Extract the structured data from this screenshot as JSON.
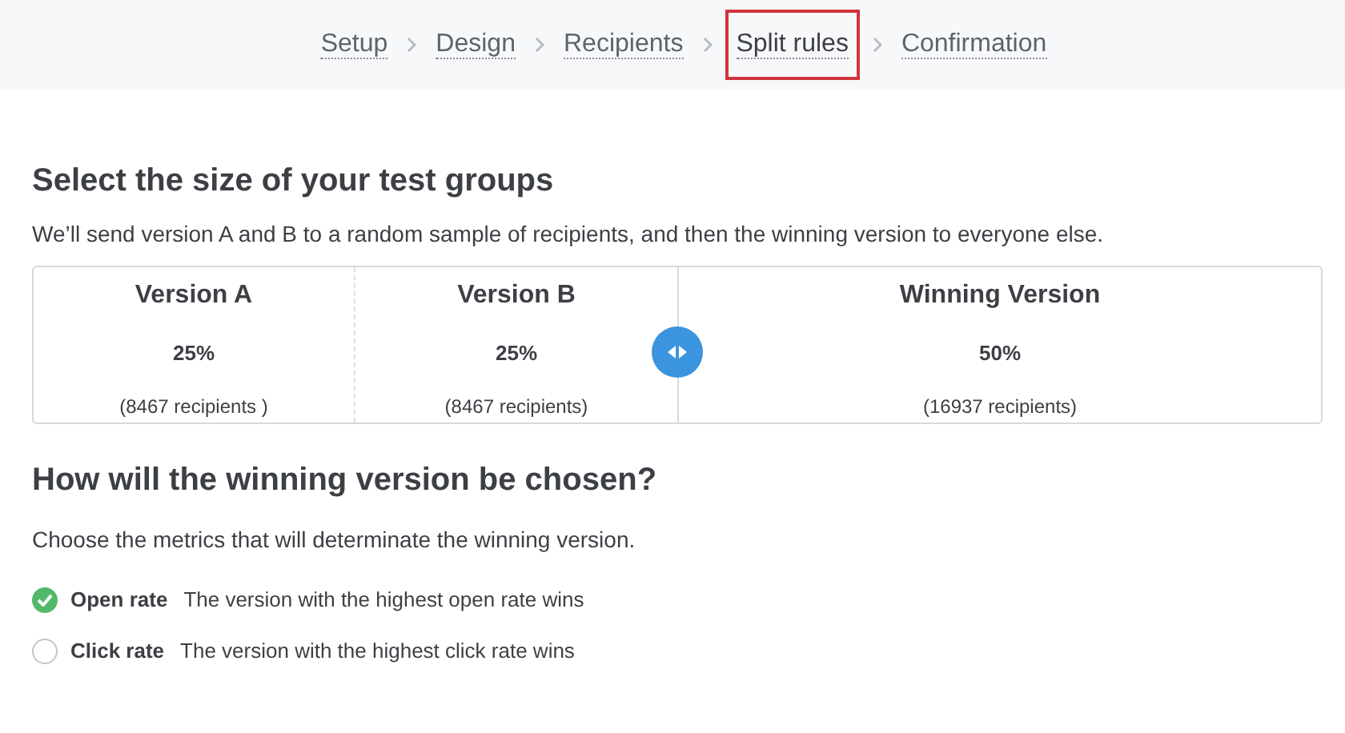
{
  "steps": [
    {
      "label": "Setup",
      "selected": false
    },
    {
      "label": "Design",
      "selected": false
    },
    {
      "label": "Recipients",
      "selected": false
    },
    {
      "label": "Split rules",
      "selected": true
    },
    {
      "label": "Confirmation",
      "selected": false
    }
  ],
  "groups_section": {
    "title": "Select the size of your test groups",
    "description": "We’ll send version A and B to a random sample of recipients, and then the winning version to everyone else.",
    "groups": [
      {
        "name": "Version A",
        "percent": "25%",
        "recipients": "(8467 recipients )"
      },
      {
        "name": "Version B",
        "percent": "25%",
        "recipients": "(8467 recipients)"
      },
      {
        "name": "Winning Version",
        "percent": "50%",
        "recipients": "(16937 recipients)"
      }
    ]
  },
  "winner_section": {
    "title": "How will the winning version be chosen?",
    "description": "Choose the metrics that will determinate the winning version.",
    "metrics": [
      {
        "name": "Open rate",
        "description": "The version with the highest open rate wins",
        "selected": true
      },
      {
        "name": "Click rate",
        "description": "The version with the highest click rate wins",
        "selected": false
      }
    ]
  }
}
